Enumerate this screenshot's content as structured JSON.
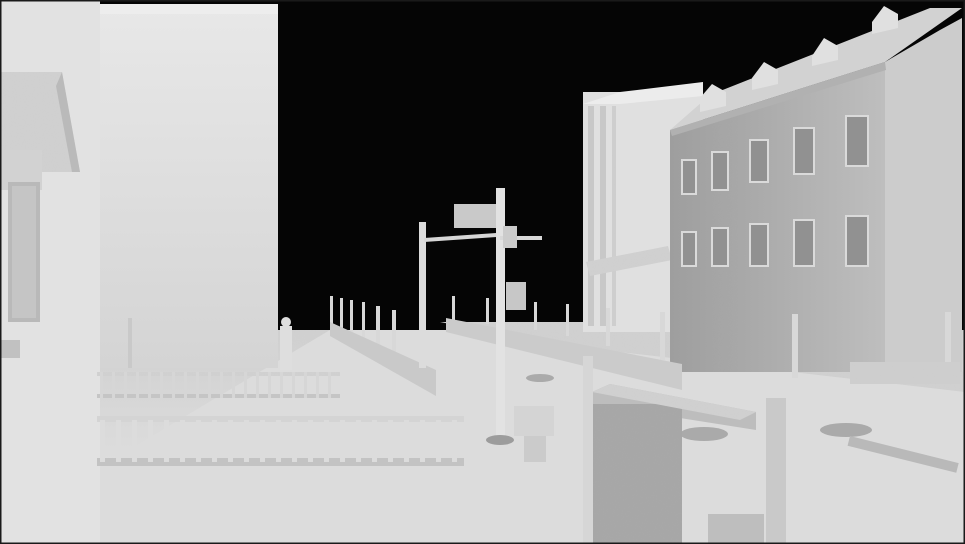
{
  "scene": {
    "description_visible_text": [],
    "palette": {
      "sky": "#000000",
      "ground": "#d6d6d6",
      "ground_shadow": "#bcbcbc",
      "building_light": "#e4e4e4",
      "building_mid": "#c9c9c9",
      "building_dark": "#a8a8a8",
      "roof": "#d0d0d0",
      "frame_border": "#1a1a1a"
    },
    "objects": [
      "left-house",
      "left-tall-building",
      "right-mansard-building",
      "right-tall-building",
      "traffic-light-pole",
      "fence-front",
      "fence-back",
      "bollards",
      "utility-box",
      "foreground-pillar"
    ]
  }
}
